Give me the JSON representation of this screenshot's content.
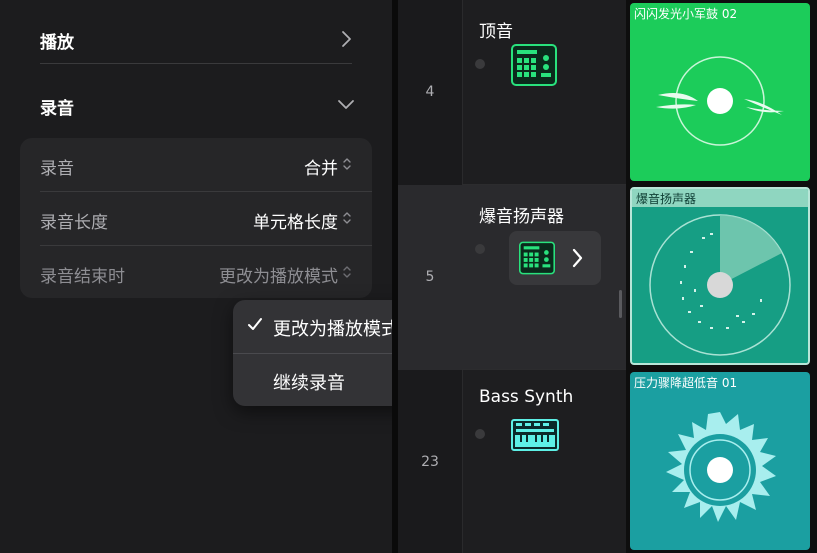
{
  "settings": {
    "playback_title": "播放",
    "recording_title": "录音",
    "rows": [
      {
        "label": "录音",
        "value": "合并"
      },
      {
        "label": "录音长度",
        "value": "单元格长度"
      },
      {
        "label": "录音结束时",
        "value": "更改为播放模式"
      }
    ]
  },
  "popup": {
    "items": [
      {
        "label": "更改为播放模式",
        "checked": true
      },
      {
        "label": "继续录音",
        "checked": false
      }
    ]
  },
  "tracks": [
    {
      "number": "4",
      "name": "顶音",
      "instrument_icon": "drum-machine-icon"
    },
    {
      "number": "5",
      "name": "爆音扬声器",
      "instrument_icon": "drum-machine-icon"
    },
    {
      "number": "23",
      "name": "Bass Synth",
      "instrument_icon": "synthesizer-icon"
    }
  ],
  "cells": [
    {
      "label": "闪闪发光小军鼓 02",
      "color": "#1ccc5a"
    },
    {
      "label": "爆音扬声器",
      "color": "#169e84"
    },
    {
      "label": "压力骤降超低音 01",
      "color": "#1b9fa1"
    }
  ],
  "colors": {
    "background": "#1c1c1e",
    "accent_icon": "#29e27d",
    "popup_background": "#333336"
  }
}
